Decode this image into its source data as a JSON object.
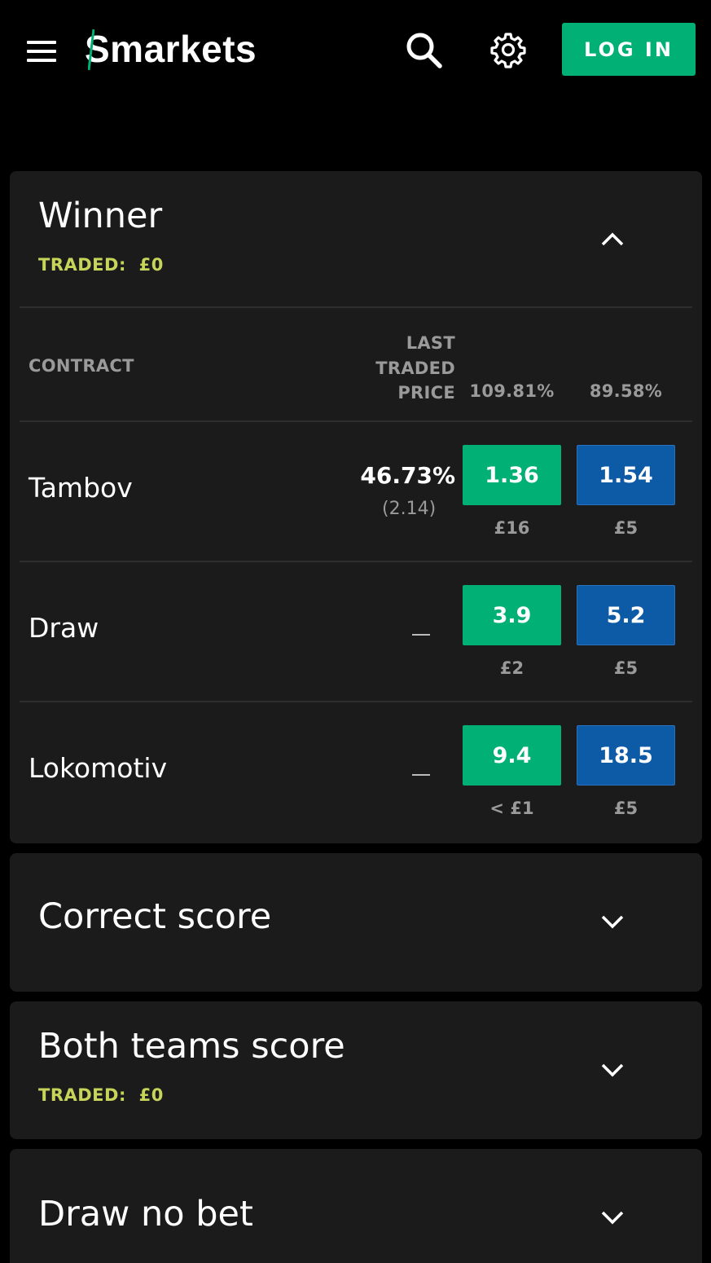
{
  "header": {
    "logo_text": "Smarkets",
    "login_label": "LOG IN",
    "icons": [
      "menu-icon",
      "search-icon",
      "gear-icon"
    ]
  },
  "colors": {
    "back": "#00b074",
    "lay": "#0d5aa7",
    "traded": "#c6d55a",
    "card_bg": "#1b1b1b"
  },
  "winner": {
    "title": "Winner",
    "traded_label": "TRADED:",
    "traded_value": "£0",
    "columns": {
      "contract": "CONTRACT",
      "ltp_line1": "LAST",
      "ltp_line2": "TRADED",
      "ltp_line3": "PRICE",
      "back_pct": "109.81%",
      "lay_pct": "89.58%"
    },
    "runners": [
      {
        "name": "Tambov",
        "ltp": "46.73%",
        "ltp_decimal": "(2.14)",
        "back": "1.36",
        "back_stake": "£16",
        "lay": "1.54",
        "lay_stake": "£5"
      },
      {
        "name": "Draw",
        "ltp": "",
        "ltp_decimal": "",
        "back": "3.9",
        "back_stake": "£2",
        "lay": "5.2",
        "lay_stake": "£5"
      },
      {
        "name": "Lokomotiv",
        "ltp": "",
        "ltp_decimal": "",
        "back": "9.4",
        "back_stake": "< £1",
        "lay": "18.5",
        "lay_stake": "£5"
      }
    ]
  },
  "markets": [
    {
      "title": "Correct score"
    },
    {
      "title": "Both teams score",
      "traded_label": "TRADED:",
      "traded_value": "£0"
    },
    {
      "title": "Draw no bet"
    }
  ]
}
